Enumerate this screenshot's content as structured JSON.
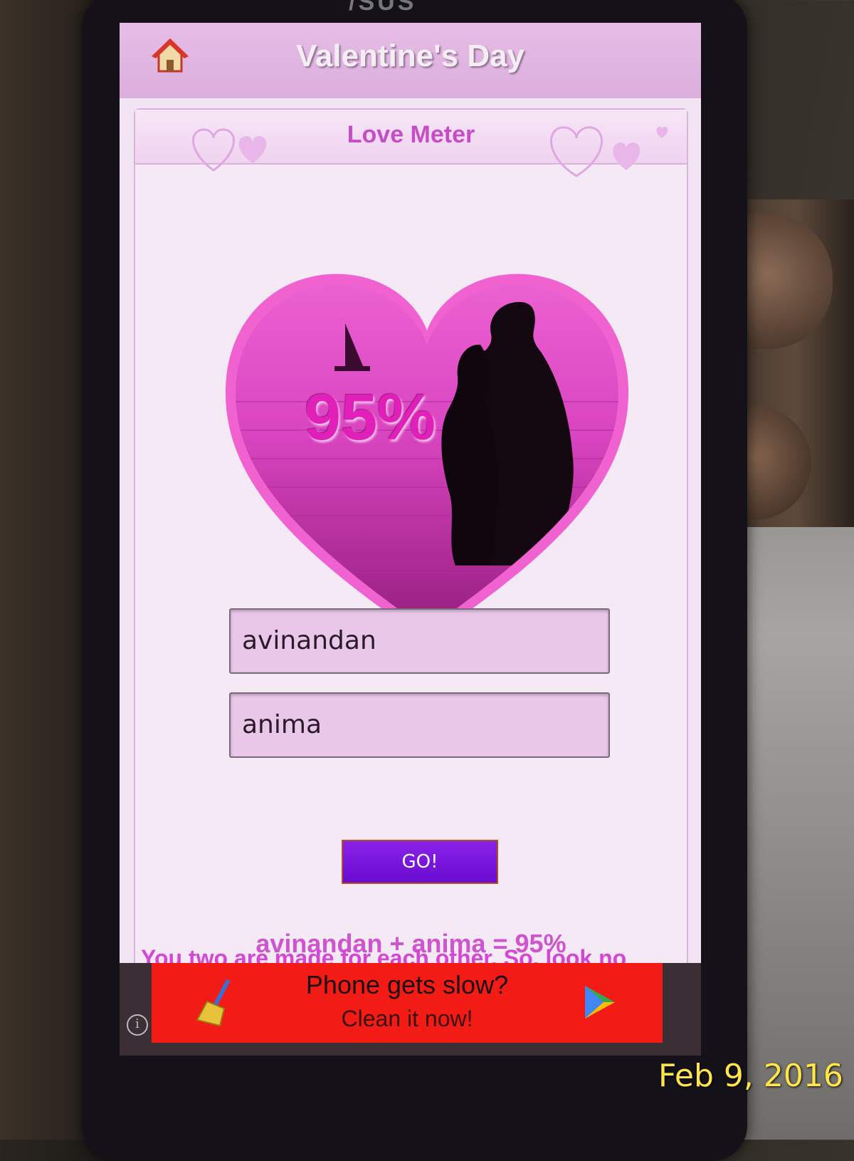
{
  "app": {
    "title": "Valentine's Day"
  },
  "panel": {
    "title": "Love Meter"
  },
  "meter": {
    "percent_text": "95%",
    "percent_value": 95
  },
  "form": {
    "name1": "avinandan",
    "name2": "anima",
    "go_label": "GO!"
  },
  "result": {
    "text": "avinandan + anima = 95%",
    "message": "You two are made for each other. So, look no"
  },
  "ad": {
    "line1": "Phone gets slow?",
    "line2": "Clean it now!",
    "info": "i"
  },
  "photo": {
    "date_stamp": "Feb 9, 2016",
    "brand": "/SUS"
  },
  "colors": {
    "accent": "#e020b8",
    "button": "#7a14e0",
    "ad_bg": "#f21b16"
  }
}
